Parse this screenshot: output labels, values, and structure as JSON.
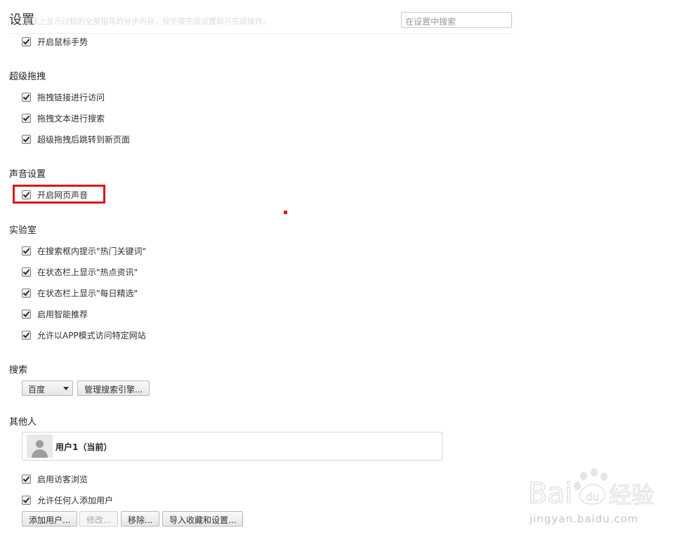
{
  "header": {
    "title": "设置",
    "faded_text": "无法上显示过程的全部指导的分步内容，按步骤完成设置即可完成操作。",
    "search_placeholder": "在设置中搜索"
  },
  "mouse": {
    "items": [
      {
        "label": "开启鼠标手势",
        "checked": true
      }
    ]
  },
  "drag": {
    "title": "超级拖拽",
    "items": [
      {
        "label": "拖拽链接进行访问",
        "checked": true
      },
      {
        "label": "拖拽文本进行搜索",
        "checked": true
      },
      {
        "label": "超级拖拽后跳转到新页面",
        "checked": true
      }
    ]
  },
  "sound": {
    "title": "声音设置",
    "items": [
      {
        "label": "开启网页声音",
        "checked": true
      }
    ]
  },
  "lab": {
    "title": "实验室",
    "items": [
      {
        "label": "在搜索框内提示\"热门关键词\"",
        "checked": true
      },
      {
        "label": "在状态栏上显示\"热点资讯\"",
        "checked": true
      },
      {
        "label": "在状态栏上显示\"每日精选\"",
        "checked": true
      },
      {
        "label": "启用智能推荐",
        "checked": true
      },
      {
        "label": "允许以APP模式访问特定网站",
        "checked": true
      }
    ]
  },
  "search": {
    "title": "搜索",
    "engine_selected": "百度",
    "manage_button": "管理搜索引擎..."
  },
  "people": {
    "title": "其他人",
    "current_user": "用户1（当前）",
    "items": [
      {
        "label": "启用访客浏览",
        "checked": true
      },
      {
        "label": "允许任何人添加用户",
        "checked": true
      }
    ],
    "buttons": {
      "add": "添加用户...",
      "edit": "修改...",
      "remove": "移除...",
      "import": "导入收藏和设置..."
    }
  },
  "watermark": {
    "brand": "Baidu经验",
    "url": "jingyan.baidu.com"
  },
  "colors": {
    "highlight": "#e0131a",
    "section_text": "#222222"
  }
}
